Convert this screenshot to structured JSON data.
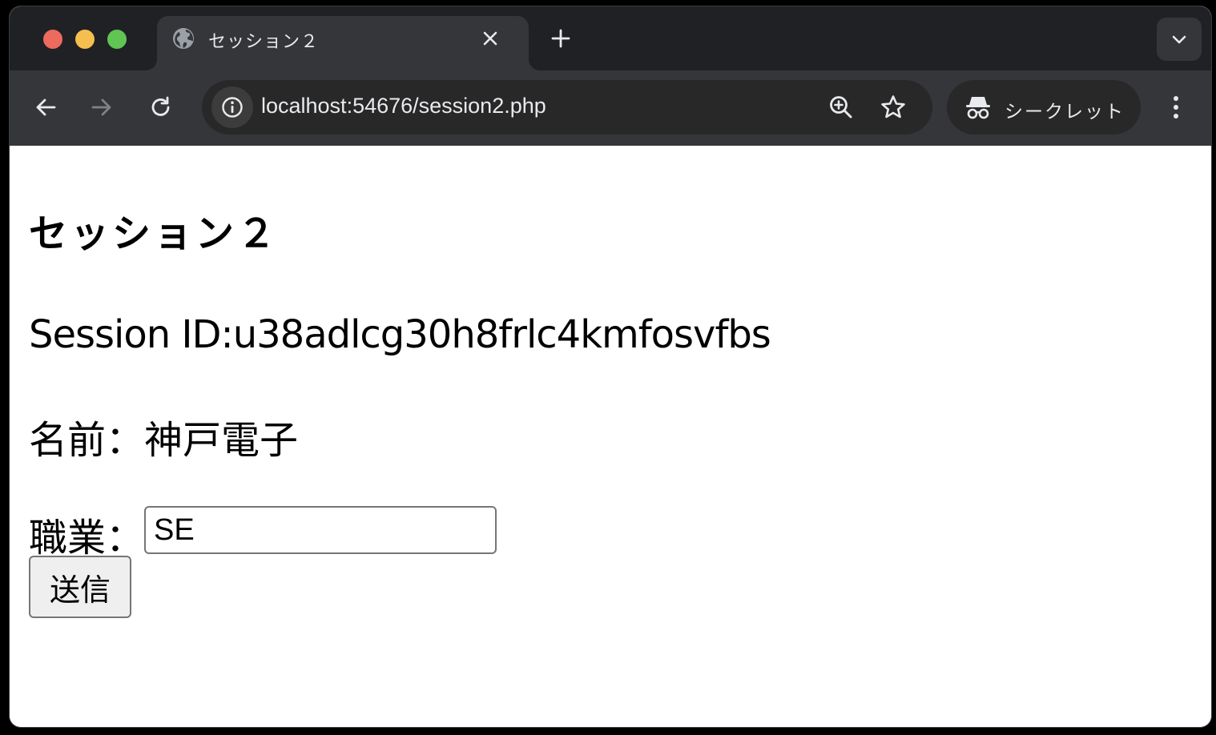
{
  "tab": {
    "title": "セッション２"
  },
  "toolbar": {
    "url": "localhost:54676/session2.php",
    "incognito_label": "シークレット"
  },
  "page": {
    "heading": "セッション２",
    "session_line": "Session ID:u38adlcg30h8frlc4kmfosvfbs",
    "name_line": "名前：神戸電子",
    "job_label": "職業：",
    "job_value": "SE",
    "submit_label": "送信"
  },
  "colors": {
    "tabstrip_bg": "#202124",
    "toolbar_bg": "#35363a",
    "omnibox_bg": "#282828",
    "traffic_red": "#ed6a5e",
    "traffic_yellow": "#f5bf4f",
    "traffic_green": "#61c554"
  },
  "icons": {
    "tab_favicon": "globe-icon",
    "tab_close": "close-icon",
    "new_tab": "plus-icon",
    "tab_search": "chevron-down-icon",
    "back": "back-arrow-icon",
    "forward": "forward-arrow-icon",
    "reload": "reload-icon",
    "site_info": "info-icon",
    "zoom": "zoom-in-icon",
    "bookmark": "star-icon",
    "incognito": "incognito-icon",
    "menu": "kebab-menu-icon"
  }
}
